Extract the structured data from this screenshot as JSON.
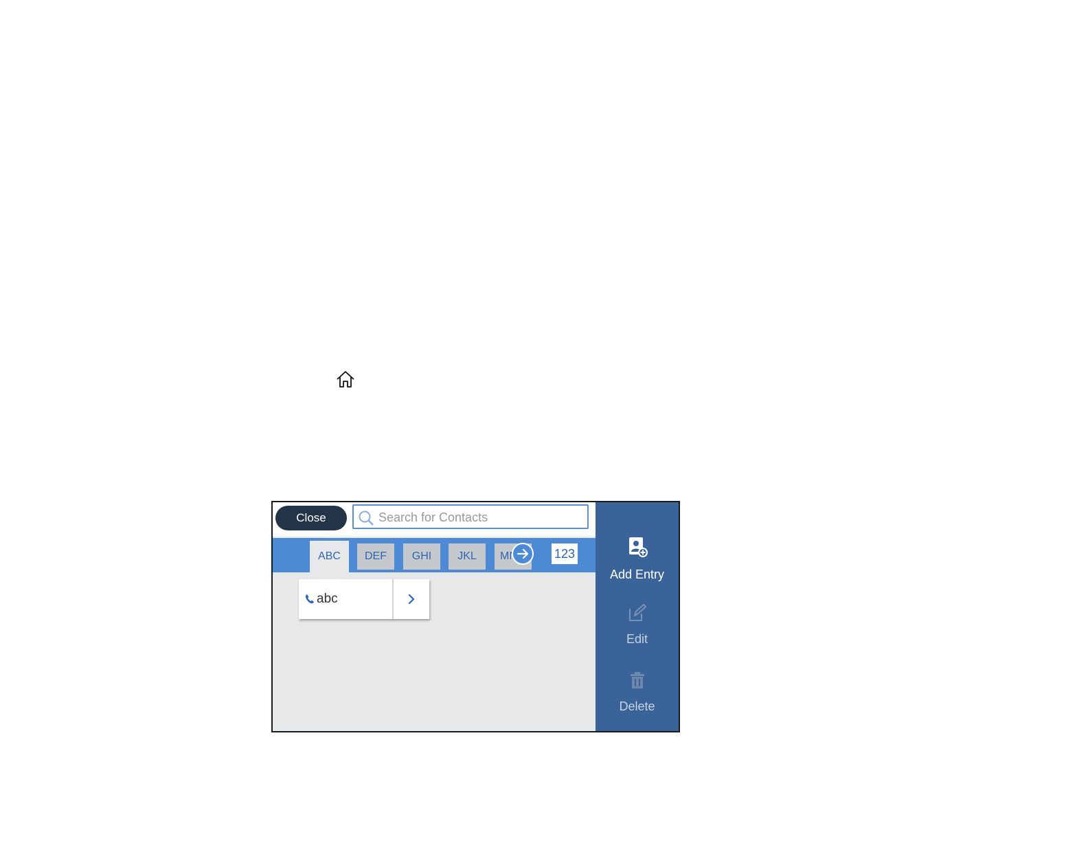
{
  "toolbar": {
    "close_label": "Close",
    "search_placeholder": "Search for Contacts"
  },
  "tabs": [
    {
      "label": "ABC",
      "active": true
    },
    {
      "label": "DEF"
    },
    {
      "label": "GHI"
    },
    {
      "label": "JKL"
    },
    {
      "label": "MN"
    }
  ],
  "numeric_tab": "123",
  "contacts": [
    {
      "name": "abc",
      "icon": "phone-icon"
    }
  ],
  "sidebar": {
    "add_entry_label": "Add Entry",
    "edit_label": "Edit",
    "delete_label": "Delete"
  },
  "colors": {
    "accent": "#4d8ad6",
    "sidebar": "#3a639a",
    "close_button": "#243448"
  }
}
